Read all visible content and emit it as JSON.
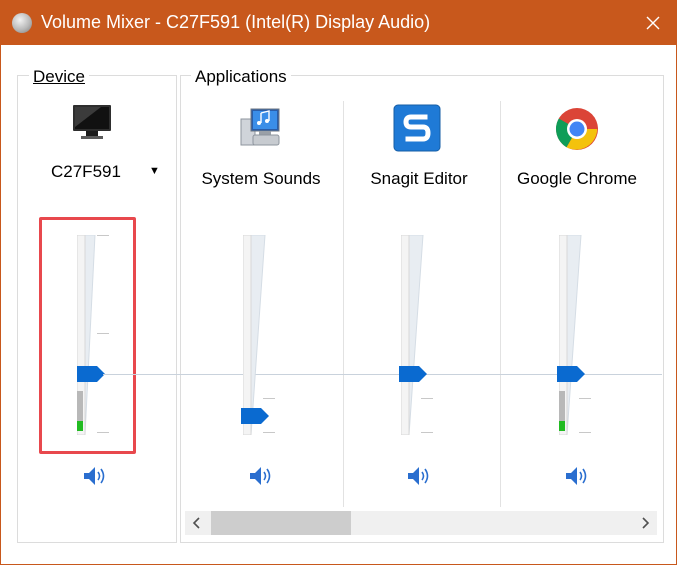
{
  "window": {
    "title": "Volume Mixer - C27F591 (Intel(R) Display Audio)",
    "close_glyph": "✕"
  },
  "device": {
    "group_label": "Device",
    "name": "C27F591",
    "dropdown_glyph": "▼",
    "icon": "monitor-icon",
    "volume_level": 0.3,
    "meter_level": 0.2,
    "mute_icon": "speaker-icon"
  },
  "applications": {
    "group_label": "Applications",
    "items": [
      {
        "name": "System Sounds",
        "icon": "system-sounds-icon",
        "volume_level": 0.1,
        "meter_level": 0.0
      },
      {
        "name": "Snagit Editor",
        "icon": "snagit-icon",
        "volume_level": 0.3,
        "meter_level": 0.0
      },
      {
        "name": "Google Chrome",
        "icon": "chrome-icon",
        "volume_level": 0.3,
        "meter_level": 0.05
      }
    ]
  },
  "scrollbar": {
    "left_arrow": "‹",
    "right_arrow": "›",
    "position": 0.0,
    "visible_fraction": 0.3
  },
  "colors": {
    "titlebar": "#c8581c",
    "thumb": "#0a6ad0",
    "meter_green": "#22bb22",
    "highlight": "#e8484d"
  }
}
